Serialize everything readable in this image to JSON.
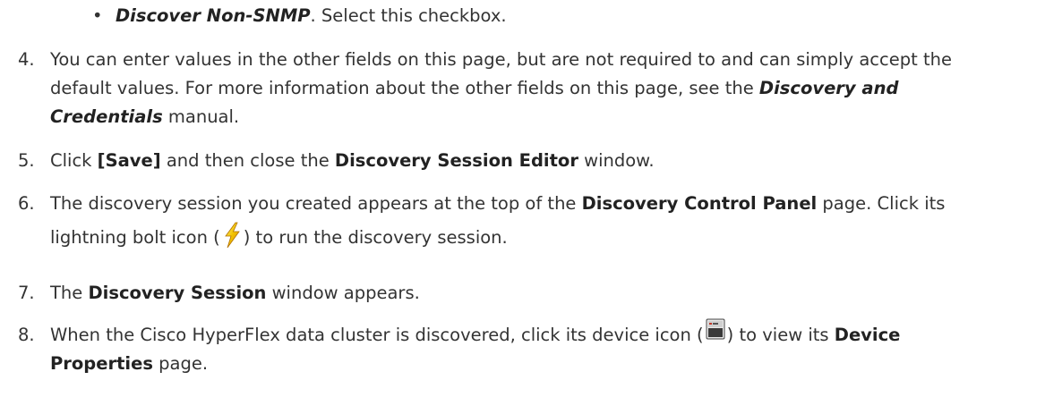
{
  "bullet": {
    "label": "Discover Non-SNMP",
    "text": ". Select this checkbox."
  },
  "steps": [
    {
      "number": "4.",
      "line1": "You can enter values in the other fields on this page, but are not required to and can simply accept the",
      "line2a": "default values. For more information about the other fields on this page, see the ",
      "line2_bold": "Discovery and",
      "line3_bold": "Credentials",
      "line3b": " manual."
    },
    {
      "number": "5.",
      "a": "Click ",
      "save": "[Save]",
      "b": " and then close the ",
      "editor": "Discovery Session Editor",
      "c": " window."
    },
    {
      "number": "6.",
      "a": "The discovery session you created appears at the top of the ",
      "panel": "Discovery Control Panel",
      "b": " page. Click its",
      "c": "lightning bolt icon (",
      "d": ") to run the discovery session."
    },
    {
      "number": "7.",
      "a": "The ",
      "session": "Discovery Session",
      "b": " window appears."
    },
    {
      "number": "8.",
      "a": "When the Cisco HyperFlex data cluster is discovered, click its device icon (",
      "b": ") to view its ",
      "device": "Device",
      "properties": "Properties",
      "c": " page."
    }
  ]
}
